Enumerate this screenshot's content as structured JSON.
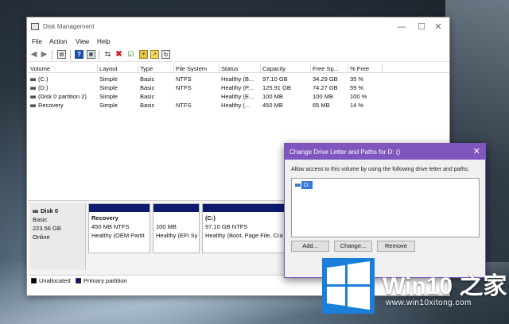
{
  "window": {
    "title": "Disk Management",
    "controls": {
      "minimize": "—",
      "maximize": "☐",
      "close": "✕"
    }
  },
  "menu": [
    "File",
    "Action",
    "View",
    "Help"
  ],
  "toolbar": {
    "icons": [
      "back-arrow-icon",
      "forward-arrow-icon",
      "console-tree-icon",
      "help-icon",
      "properties-icon",
      "connect-disk-icon",
      "delete-icon",
      "check-icon",
      "new-folder-icon",
      "export-icon",
      "refresh-icon"
    ]
  },
  "volume_table": {
    "headers": [
      "Volume",
      "Layout",
      "Type",
      "File System",
      "Status",
      "Capacity",
      "Free Sp...",
      "% Free"
    ],
    "rows": [
      [
        "(C:)",
        "Simple",
        "Basic",
        "NTFS",
        "Healthy (B...",
        "97.10 GB",
        "34.29 GB",
        "35 %"
      ],
      [
        "(D:)",
        "Simple",
        "Basic",
        "NTFS",
        "Healthy (P...",
        "125.91 GB",
        "74.27 GB",
        "59 %"
      ],
      [
        "(Disk 0 partition 2)",
        "Simple",
        "Basic",
        "",
        "Healthy (E...",
        "100 MB",
        "100 MB",
        "100 %"
      ],
      [
        "Recovery",
        "Simple",
        "Basic",
        "NTFS",
        "Healthy (...",
        "450 MB",
        "65 MB",
        "14 %"
      ]
    ]
  },
  "disk": {
    "name": "Disk 0",
    "type": "Basic",
    "size": "223.56 GB",
    "status": "Online",
    "partitions": [
      {
        "name": "Recovery",
        "size": "450 MB NTFS",
        "status": "Healthy (OEM Partit"
      },
      {
        "name": "",
        "size": "100 MB",
        "status": "Healthy (EFI Sy"
      },
      {
        "name": "(C:)",
        "size": "97.10 GB NTFS",
        "status": "Healthy (Boot, Page File, Cra"
      }
    ]
  },
  "legend": {
    "unallocated": "Unallocated",
    "primary": "Primary partition",
    "colors": {
      "unallocated": "#000000",
      "primary": "#101a6e"
    }
  },
  "dialog": {
    "title": "Change Drive Letter and Paths for D: ()",
    "close": "✕",
    "instruction": "Allow access to this volume by using the following drive letter and paths:",
    "list_items": [
      "D:"
    ],
    "buttons": {
      "add": "Add...",
      "change": "Change...",
      "remove": "Remove"
    },
    "accent_color": "#7e56be"
  },
  "watermark": {
    "brand": "Win10 之家",
    "url": "www.win10xitong.com"
  }
}
